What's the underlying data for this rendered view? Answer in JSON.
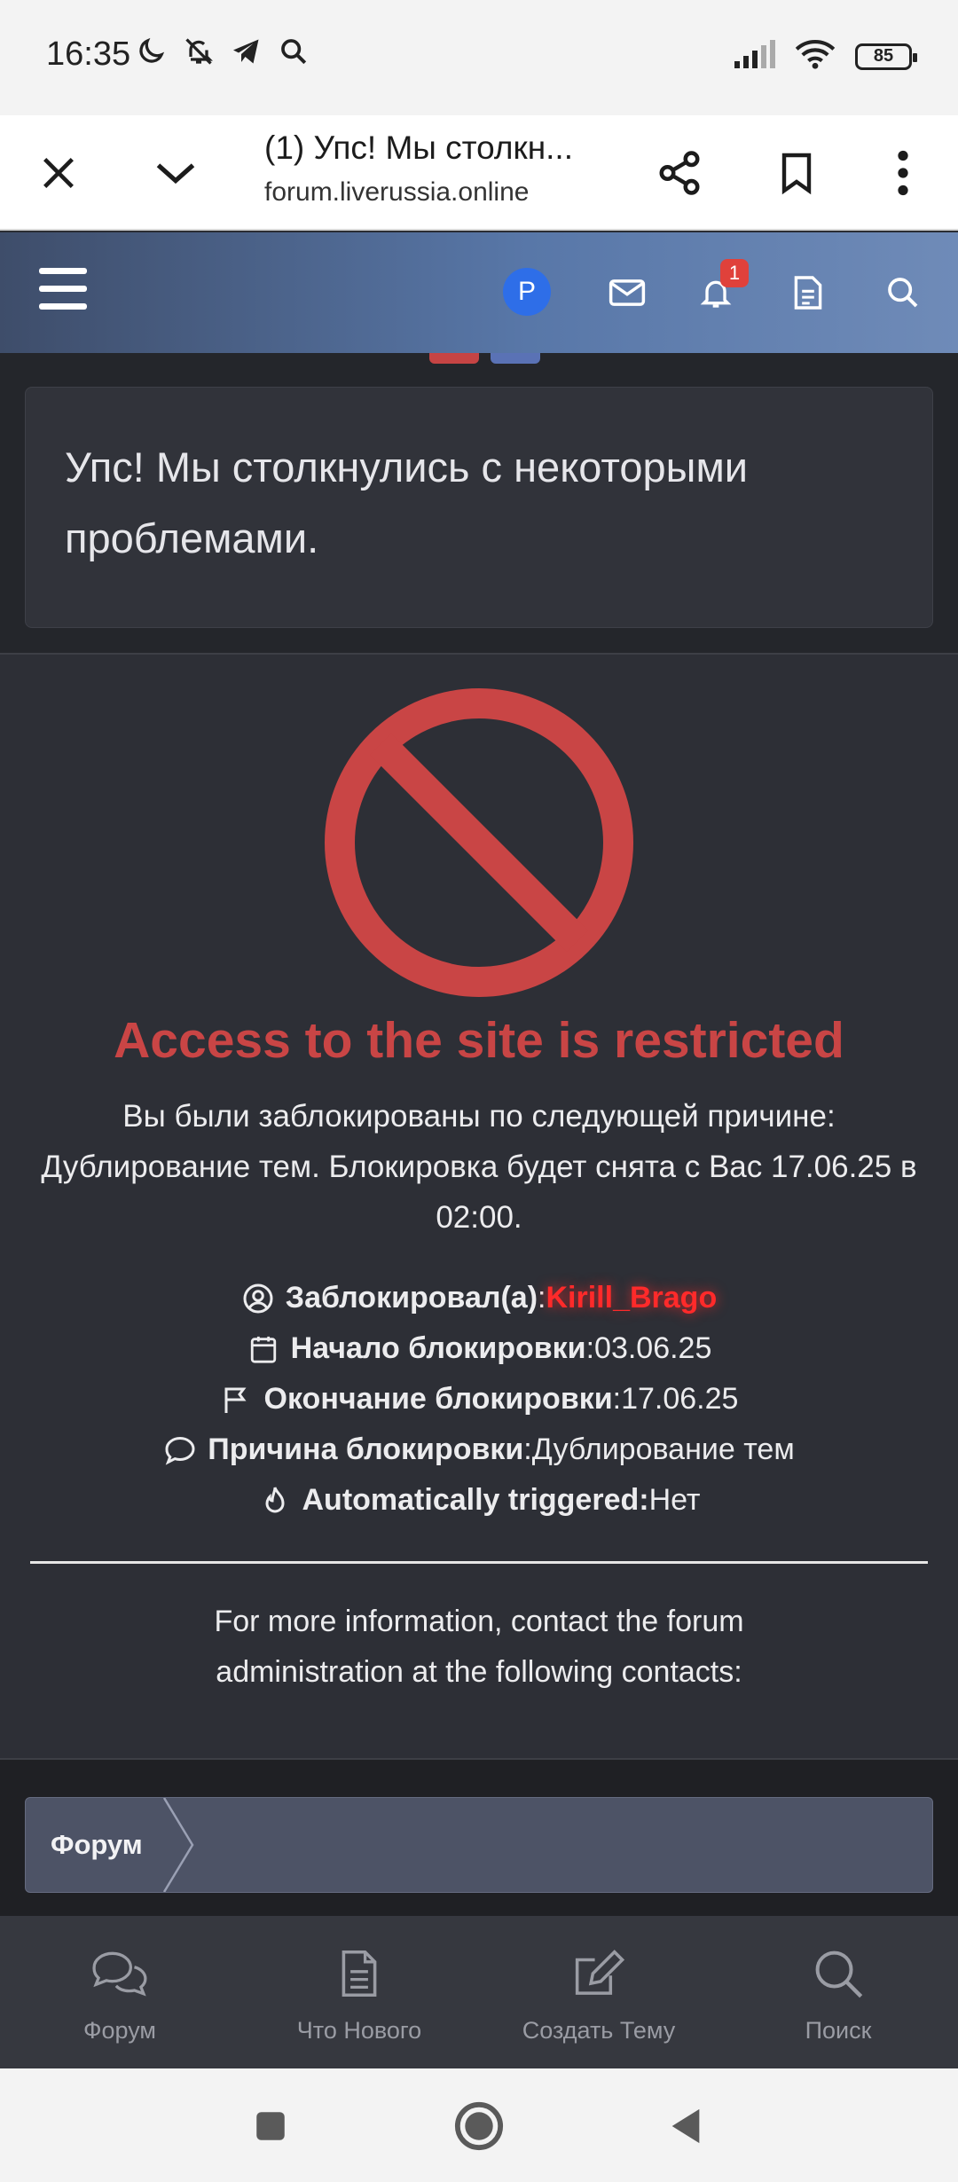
{
  "status_bar": {
    "time": "16:35",
    "battery": "85",
    "icons_left": [
      "moon-icon",
      "bell-off-icon",
      "telegram-icon",
      "search-icon"
    ],
    "icons_right": [
      "signal-icon",
      "wifi-icon",
      "battery-icon"
    ]
  },
  "browser": {
    "title": "(1) Упс! Мы столкн...",
    "url": "forum.liverussia.online",
    "buttons": [
      "close-icon",
      "chevron-down-icon",
      "share-icon",
      "bookmark-icon",
      "more-icon"
    ]
  },
  "forum_header": {
    "avatar_letter": "P",
    "notification_count": "1",
    "icons": [
      "hamburger-icon",
      "mail-icon",
      "bell-icon",
      "document-icon",
      "search-icon"
    ],
    "avatar_color": "#2e6ee8"
  },
  "error": {
    "title": "Упс! Мы столкнулись с некоторыми проблемами."
  },
  "ban": {
    "title": "Access to the site is restricted",
    "description": "Вы были заблокированы по следующей причине: Дублирование тем. Блокировка будет снята с Вас 17.06.25 в 02:00.",
    "accent_color": "#c94545",
    "rows": [
      {
        "label": "Заблокировал(а)",
        "sep": ": ",
        "value": "Kirill_Brago",
        "icon": "user-circle-icon"
      },
      {
        "label": "Начало блокировки",
        "sep": ": ",
        "value": "03.06.25",
        "icon": "calendar-icon"
      },
      {
        "label": "Окончание блокировки",
        "sep": ": ",
        "value": "17.06.25",
        "icon": "flag-icon"
      },
      {
        "label": "Причина блокировки",
        "sep": ": ",
        "value": "Дублирование тем",
        "icon": "comment-icon"
      },
      {
        "label": "Automatically triggered:",
        "sep": " ",
        "value": "Нет",
        "icon": "fire-icon"
      }
    ],
    "contact": "For more information, contact the forum administration at the following contacts:"
  },
  "breadcrumb": {
    "items": [
      "Форум"
    ]
  },
  "bottom_nav": {
    "items": [
      {
        "label": "Форум",
        "icon": "comments-icon"
      },
      {
        "label": "Что Нового",
        "icon": "file-text-icon"
      },
      {
        "label": "Создать Тему",
        "icon": "edit-icon"
      },
      {
        "label": "Поиск",
        "icon": "search-icon"
      }
    ]
  },
  "system_nav": {
    "buttons": [
      "recents-icon",
      "home-icon",
      "back-icon"
    ]
  }
}
